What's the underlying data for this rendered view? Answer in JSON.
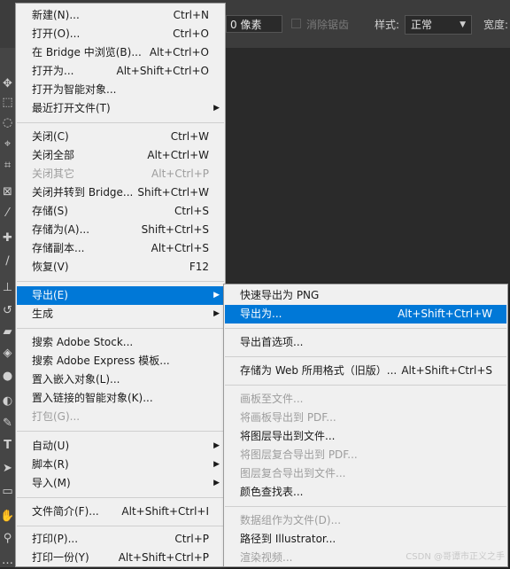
{
  "options_bar": {
    "pixels_value": "0 像素",
    "antialias_label": "消除锯齿",
    "style_label": "样式:",
    "style_value": "正常",
    "width_label": "宽度:"
  },
  "file_menu": [
    {
      "label": "新建(N)...",
      "shortcut": "Ctrl+N"
    },
    {
      "label": "打开(O)...",
      "shortcut": "Ctrl+O"
    },
    {
      "label": "在 Bridge 中浏览(B)...",
      "shortcut": "Alt+Ctrl+O"
    },
    {
      "label": "打开为...",
      "shortcut": "Alt+Shift+Ctrl+O"
    },
    {
      "label": "打开为智能对象...",
      "shortcut": ""
    },
    {
      "label": "最近打开文件(T)",
      "shortcut": ""
    },
    {
      "label": "关闭(C)",
      "shortcut": "Ctrl+W"
    },
    {
      "label": "关闭全部",
      "shortcut": "Alt+Ctrl+W"
    },
    {
      "label": "关闭其它",
      "shortcut": "Alt+Ctrl+P"
    },
    {
      "label": "关闭并转到 Bridge...",
      "shortcut": "Shift+Ctrl+W"
    },
    {
      "label": "存储(S)",
      "shortcut": "Ctrl+S"
    },
    {
      "label": "存储为(A)...",
      "shortcut": "Shift+Ctrl+S"
    },
    {
      "label": "存储副本...",
      "shortcut": "Alt+Ctrl+S"
    },
    {
      "label": "恢复(V)",
      "shortcut": "F12"
    },
    {
      "label": "导出(E)",
      "shortcut": ""
    },
    {
      "label": "生成",
      "shortcut": ""
    },
    {
      "label": "搜索 Adobe Stock...",
      "shortcut": ""
    },
    {
      "label": "搜索 Adobe Express 模板...",
      "shortcut": ""
    },
    {
      "label": "置入嵌入对象(L)...",
      "shortcut": ""
    },
    {
      "label": "置入链接的智能对象(K)...",
      "shortcut": ""
    },
    {
      "label": "打包(G)...",
      "shortcut": ""
    },
    {
      "label": "自动(U)",
      "shortcut": ""
    },
    {
      "label": "脚本(R)",
      "shortcut": ""
    },
    {
      "label": "导入(M)",
      "shortcut": ""
    },
    {
      "label": "文件简介(F)...",
      "shortcut": "Alt+Shift+Ctrl+I"
    },
    {
      "label": "打印(P)...",
      "shortcut": "Ctrl+P"
    },
    {
      "label": "打印一份(Y)",
      "shortcut": "Alt+Shift+Ctrl+P"
    }
  ],
  "export_submenu": [
    {
      "label": "快速导出为 PNG",
      "shortcut": ""
    },
    {
      "label": "导出为...",
      "shortcut": "Alt+Shift+Ctrl+W"
    },
    {
      "label": "导出首选项...",
      "shortcut": ""
    },
    {
      "label": "存储为 Web 所用格式（旧版）...",
      "shortcut": "Alt+Shift+Ctrl+S"
    },
    {
      "label": "画板至文件...",
      "shortcut": ""
    },
    {
      "label": "将画板导出到 PDF...",
      "shortcut": ""
    },
    {
      "label": "将图层导出到文件...",
      "shortcut": ""
    },
    {
      "label": "将图层复合导出到 PDF...",
      "shortcut": ""
    },
    {
      "label": "图层复合导出到文件...",
      "shortcut": ""
    },
    {
      "label": "颜色查找表...",
      "shortcut": ""
    },
    {
      "label": "数据组作为文件(D)...",
      "shortcut": ""
    },
    {
      "label": "路径到 Illustrator...",
      "shortcut": ""
    },
    {
      "label": "渲染视频...",
      "shortcut": ""
    }
  ],
  "arrow_glyph": "▶",
  "watermark": "CSDN @哥谭市正义之手"
}
